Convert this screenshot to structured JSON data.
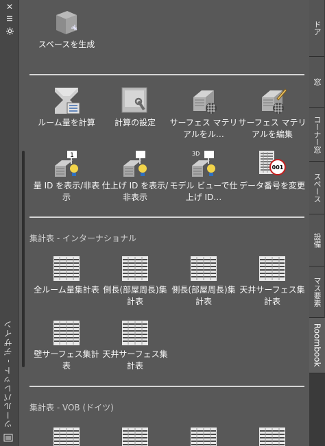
{
  "palette": {
    "panel_title": "ツールパレット - デザイン",
    "controls": [
      {
        "name": "close-icon",
        "glyph": "✕"
      },
      {
        "name": "auto-hide-icon",
        "glyph": "⇅"
      },
      {
        "name": "properties-icon",
        "glyph": "✲"
      }
    ]
  },
  "top_tool": {
    "label": "スペースを生成",
    "icon": "space-generate-icon"
  },
  "tools_row1": [
    {
      "label": "ルーム量を計算",
      "icon": "room-quantity-icon"
    },
    {
      "label": "計算の設定",
      "icon": "calc-settings-icon"
    },
    {
      "label": "サーフェス マテリアルをル…",
      "icon": "surface-material-icon"
    },
    {
      "label": "サーフェス マテリアルを編集",
      "icon": "surface-material-edit-icon"
    }
  ],
  "tools_row2": [
    {
      "label": "量 ID を表示/非表示",
      "icon": "quantity-id-icon",
      "badge": "1"
    },
    {
      "label": "仕上げ ID を表示/非表示",
      "icon": "finish-id-icon",
      "badge": ""
    },
    {
      "label": "モデル ビューで仕上げ ID…",
      "icon": "model-view-finish-icon",
      "badge": "3D"
    },
    {
      "label": "データ番号を変更",
      "icon": "data-number-icon",
      "badge": "001"
    }
  ],
  "section_international": {
    "heading": "集計表 - インターナショナル",
    "tools": [
      {
        "label": "全ルーム量集計表"
      },
      {
        "label": "側長(部屋周長)集計表"
      },
      {
        "label": "側長(部屋周長)集計表"
      },
      {
        "label": "天井サーフェス集計表"
      },
      {
        "label": "壁サーフェス集計表"
      },
      {
        "label": "天井サーフェス集計表"
      }
    ]
  },
  "section_vob": {
    "heading": "集計表 - VOB (ドイツ)"
  },
  "tabs": [
    {
      "label": "ドア",
      "active": false
    },
    {
      "label": "窓",
      "active": false
    },
    {
      "label": "コーナー窓",
      "active": false
    },
    {
      "label": "スペース",
      "active": false
    },
    {
      "label": "設備",
      "active": false
    },
    {
      "label": "マス要素",
      "active": false
    },
    {
      "label": "Roombook",
      "active": true
    }
  ]
}
